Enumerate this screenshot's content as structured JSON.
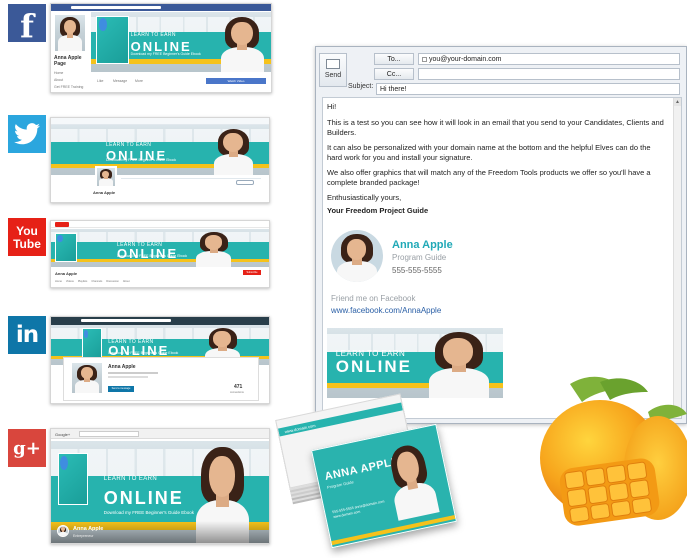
{
  "platforms": [
    {
      "key": "facebook",
      "icon_text": "f"
    },
    {
      "key": "twitter"
    },
    {
      "key": "youtube",
      "icon_line1": "You",
      "icon_line2": "Tube"
    },
    {
      "key": "linkedin",
      "icon_text": "in"
    },
    {
      "key": "googleplus",
      "icon_text": "g+"
    }
  ],
  "banner": {
    "line1": "LEARN TO EARN",
    "line2": "ONLINE",
    "line3": "Download my FREE Beginner's Guide Ebook"
  },
  "facebook": {
    "name_line1": "Anna Apple",
    "name_line2": "Page",
    "nav": [
      "Home",
      "About",
      "Get FREE Training"
    ],
    "actions": [
      "Like",
      "Message",
      "More"
    ],
    "cta": "Watch Video"
  },
  "twitter": {
    "name": "Anna Apple"
  },
  "youtube": {
    "channel": "Anna Apple",
    "tabs": [
      "Home",
      "Videos",
      "Playlists",
      "Channels",
      "Discussion",
      "About"
    ],
    "subscribe": "Subscribe"
  },
  "linkedin": {
    "name": "Anna Apple",
    "connect": "Send a message",
    "connections": "471",
    "connections_label": "connections"
  },
  "googleplus": {
    "search_label": "Google+",
    "name": "Anna Apple",
    "role": "Entrepreneur"
  },
  "email": {
    "send_label": "Send",
    "to_label": "To...",
    "cc_label": "Cc...",
    "subject_label": "Subject:",
    "to_value": "you@your-domain.com",
    "cc_value": "",
    "subject_value": "Hi there!",
    "greeting": "Hi!",
    "para1": "This is a test so you can see how it will look in an email that you send to your Candidates, Clients and Builders.",
    "para2": "It can also be personalized with your domain name at the bottom and the helpful Elves can do the hard work for you and install your signature.",
    "para3": "We also offer graphics that will match any of the Freedom Tools products we offer so you'll have a complete branded package!",
    "closing": "Enthusiastically yours,",
    "signoff": "Your Freedom Project Guide",
    "sig_name": "Anna Apple",
    "sig_role": "Program Guide",
    "sig_phone": "555-555-5555",
    "sig_friend": "Friend me on Facebook",
    "sig_url": "www.facebook.com/AnnaApple"
  },
  "card": {
    "back_url": "www.domain.com",
    "name": "ANNA APPLE",
    "role": "Program Guide",
    "info": "555-555-5555  anna@domain.com  www.domain.com"
  },
  "colors": {
    "teal": "#27b3ae",
    "yellow": "#f5c21b",
    "facebook": "#3b5998",
    "twitter": "#2ba6de",
    "youtube": "#e62117",
    "linkedin": "#0e76a8",
    "googleplus": "#d9463d"
  }
}
